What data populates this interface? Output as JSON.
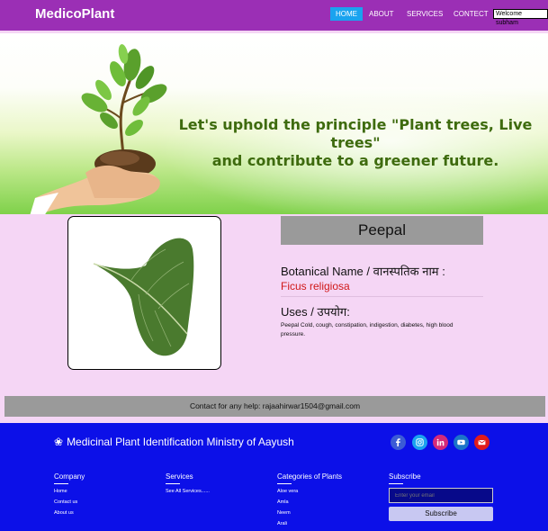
{
  "navbar": {
    "brand": "MedicoPlant",
    "items": [
      {
        "label": "HOME",
        "active": true
      },
      {
        "label": "ABOUT"
      },
      {
        "label": "SERVICES"
      },
      {
        "label": "CONTECT"
      }
    ],
    "welcome": "Welcome subham"
  },
  "hero": {
    "line1": "Let's uphold the principle \"Plant trees, Live trees\"",
    "line2": "and contribute to a greener future."
  },
  "plant": {
    "name": "Peepal",
    "botanical_label": "Botanical Name / वानस्पतिक नाम :",
    "botanical_value": "Ficus religiosa",
    "uses_label": "Uses / उपयोग:",
    "uses_text": "Peepal Cold, cough, constipation, indigestion, diabetes, high blood pressure."
  },
  "contact": {
    "text": "Contact for any help: rajaahirwar1504@gmail.com"
  },
  "footer": {
    "title": "Medicinal Plant Identification Ministry of Aayush",
    "social_icons": [
      "facebook-icon",
      "instagram-icon",
      "linkedin-icon",
      "youtube-icon",
      "mail-icon"
    ],
    "company": {
      "heading": "Company",
      "links": [
        "Home",
        "Contact us",
        "About us"
      ]
    },
    "services": {
      "heading": "Services",
      "links": [
        "See All Services......"
      ]
    },
    "categories": {
      "heading": "Categories of Plants",
      "links": [
        "Aloe vera",
        "Amla",
        "Neem",
        "Arali"
      ]
    },
    "subscribe": {
      "heading": "Subscribe",
      "placeholder": "Enter your email",
      "button": "Subscribe"
    }
  },
  "colors": {
    "navbar": "#9b2fb5",
    "active": "#1aa3ef",
    "footer": "#0c10e8",
    "body": "#f5d6f5",
    "accent_red": "#d01818"
  }
}
